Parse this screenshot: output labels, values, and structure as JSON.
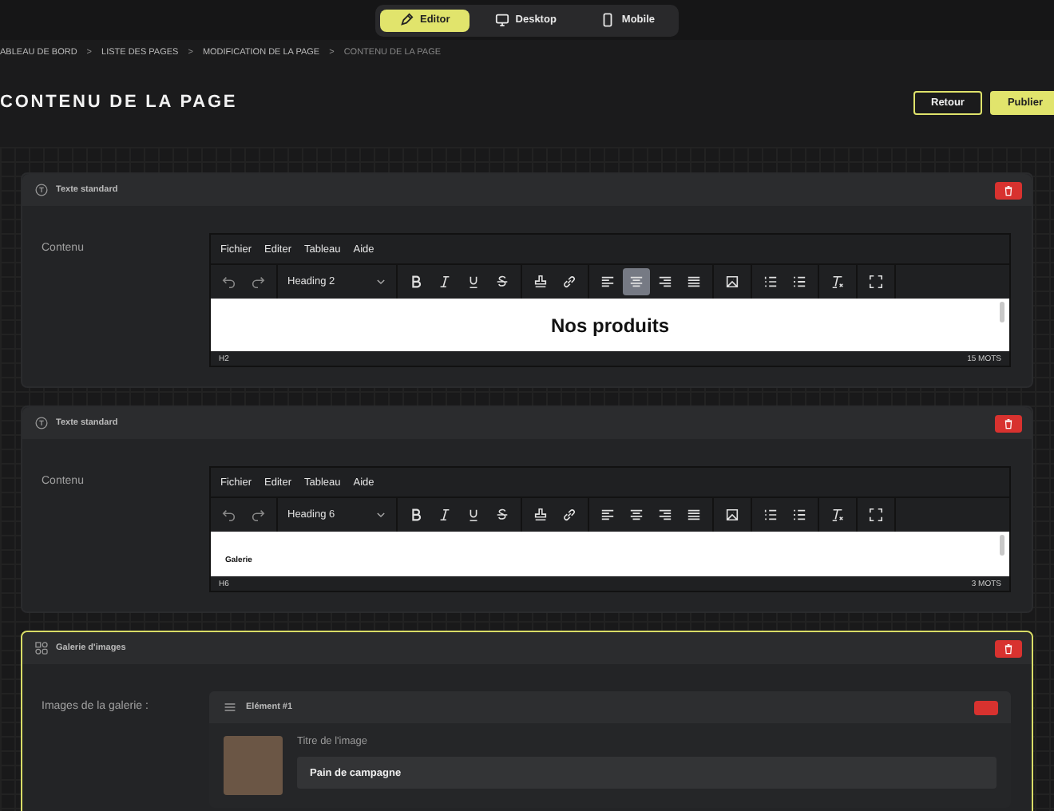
{
  "view_toggle": [
    {
      "kind": "editor",
      "label": "Editor",
      "selected": true
    },
    {
      "kind": "desktop",
      "label": "Desktop",
      "selected": false
    },
    {
      "kind": "mobile",
      "label": "Mobile",
      "selected": false
    }
  ],
  "breadcrumb": [
    {
      "label": "ABLEAU DE BORD",
      "current": false
    },
    {
      "label": "LISTE DES PAGES",
      "current": false
    },
    {
      "label": "MODIFICATION DE LA PAGE",
      "current": false
    },
    {
      "label": "CONTENU DE LA PAGE",
      "current": true
    }
  ],
  "breadcrumb_separator": ">",
  "page_title": "CONTENU DE LA PAGE",
  "actions": [
    {
      "kind": "outline",
      "label": "Retour"
    },
    {
      "kind": "primary",
      "label": "Publier"
    }
  ],
  "toolbar_groups": [
    {
      "tools": [
        {
          "kind": "undo"
        },
        {
          "kind": "redo"
        }
      ]
    },
    {
      "tools": [
        {
          "kind": "format-select"
        }
      ]
    },
    {
      "tools": [
        {
          "kind": "bold"
        },
        {
          "kind": "italic"
        },
        {
          "kind": "underline"
        },
        {
          "kind": "strike"
        }
      ]
    },
    {
      "tools": [
        {
          "kind": "stamp"
        },
        {
          "kind": "link"
        }
      ]
    },
    {
      "tools": [
        {
          "kind": "alignment"
        }
      ]
    },
    {
      "tools": [
        {
          "kind": "image"
        }
      ]
    },
    {
      "tools": [
        {
          "kind": "ordered-list"
        },
        {
          "kind": "bullet-list"
        }
      ]
    },
    {
      "tools": [
        {
          "kind": "clear-format"
        }
      ]
    },
    {
      "tools": [
        {
          "kind": "fullscreen"
        }
      ]
    }
  ],
  "blocks": [
    {
      "kind": "text",
      "title": "Texte standard",
      "selected": false,
      "field_label": "Contenu",
      "editor": {
        "menu": [
          "Fichier",
          "Editer",
          "Tableau",
          "Aide"
        ],
        "format": "Heading 2",
        "alignment": [
          {
            "kind": "left",
            "selected": false
          },
          {
            "kind": "center",
            "selected": true
          },
          {
            "kind": "right",
            "selected": false
          },
          {
            "kind": "justify",
            "selected": false
          }
        ],
        "content": {
          "kind": "h2",
          "text": "Nos produits"
        },
        "path": "H2",
        "word_count": "15 MOTS"
      }
    },
    {
      "kind": "text",
      "title": "Texte standard",
      "selected": false,
      "field_label": "Contenu",
      "editor": {
        "menu": [
          "Fichier",
          "Editer",
          "Tableau",
          "Aide"
        ],
        "format": "Heading 6",
        "alignment": [
          {
            "kind": "left",
            "selected": false
          },
          {
            "kind": "center",
            "selected": false
          },
          {
            "kind": "right",
            "selected": false
          },
          {
            "kind": "justify",
            "selected": false
          }
        ],
        "content": {
          "kind": "h6",
          "text": "Galerie"
        },
        "path": "H6",
        "word_count": "3 MOTS"
      }
    },
    {
      "kind": "gallery",
      "title": "Galerie d'images",
      "selected": true,
      "field_label": "Images de la galerie :",
      "items": [
        {
          "title": "Elément #1",
          "field_label": "Titre de l'image",
          "value": "Pain de campagne"
        }
      ]
    }
  ]
}
